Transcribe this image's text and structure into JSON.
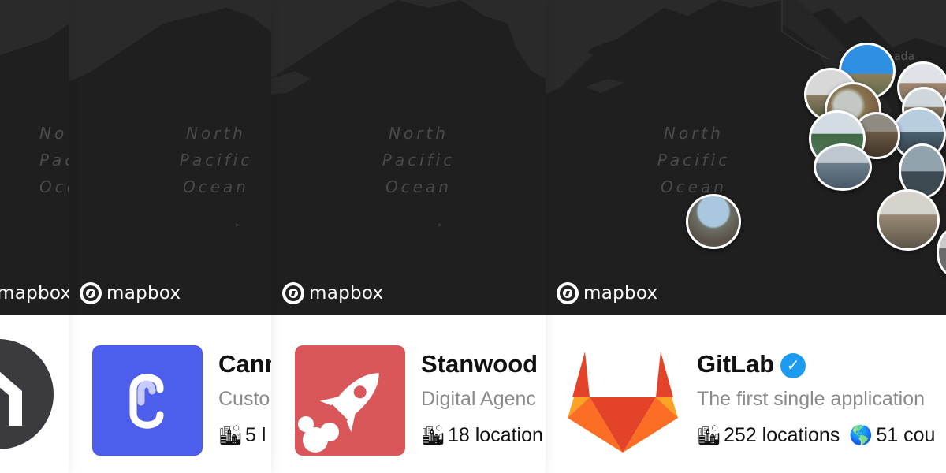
{
  "map": {
    "attribution": "mapbox",
    "ocean_label": [
      "North",
      "Pacific",
      "Ocean"
    ],
    "ocean_label_clipped": [
      "No",
      "Pac",
      "Oce"
    ],
    "region_label_clipped": "ada"
  },
  "cards": [
    {
      "logo_icon": "house-logo",
      "logo_color": "#3a3a3f"
    },
    {
      "name": "Cann",
      "tagline": "Custo",
      "locations": "5 l",
      "logo_icon": "c-letter-logo",
      "logo_color": "#4c5eeb"
    },
    {
      "name": "Stanwood",
      "tagline": "Digital Agenc",
      "locations": "18 location",
      "logo_icon": "rocket-logo",
      "logo_color": "#d9575a"
    },
    {
      "name": "GitLab",
      "verified_icon": "verified-check-icon",
      "tagline": "The first single application",
      "locations": "252 locations",
      "countries": "51 cou",
      "logo_icon": "gitlab-fox-logo"
    }
  ],
  "icons": {
    "locations": "cityscape-icon",
    "countries": "globe-icon"
  }
}
